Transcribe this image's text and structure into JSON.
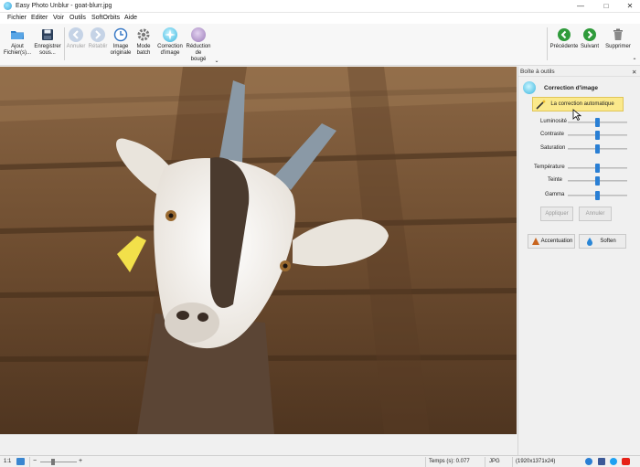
{
  "window": {
    "title": "Easy Photo Unblur - goat-blurr.jpg"
  },
  "menu": [
    "Fichier",
    "Editer",
    "Voir",
    "Outils",
    "SoftOrbits",
    "Aide"
  ],
  "toolbar": {
    "add_files": [
      "Ajout",
      "Fichier(s)..."
    ],
    "save_as": [
      "Enregistrer",
      "sous..."
    ],
    "undo": "Annuler",
    "redo": "Rétablir",
    "original_image": [
      "Image",
      "originale"
    ],
    "batch_mode": [
      "Mode",
      "batch"
    ],
    "image_correction": [
      "Correction",
      "d'image"
    ],
    "shake_reduction": [
      "Réduction",
      "de",
      "bougé"
    ],
    "previous": "Précédente",
    "next": "Suivant",
    "delete": "Supprimer"
  },
  "toolbox": {
    "title": "Boîte à outils",
    "section": "Correction d'image",
    "auto_button": "La correction automatique",
    "sliders": [
      {
        "label": "Luminosité",
        "value": 0.5
      },
      {
        "label": "Contraste",
        "value": 0.5
      },
      {
        "label": "Saturation",
        "value": 0.5
      },
      {
        "label": "Température",
        "value": 0.5
      },
      {
        "label": "Teinte",
        "value": 0.5
      },
      {
        "label": "Gamma",
        "value": 0.5
      }
    ],
    "apply": "Appliquer",
    "cancel": "Annuler",
    "sharpen": "Accentuation",
    "soften": "Soften"
  },
  "statusbar": {
    "zoom_ratio": "1:1",
    "time": "Temps (s): 0.077",
    "format": "JPG",
    "dimensions": "(1920x1371x24)"
  },
  "colors": {
    "accent": "#2a7fd4",
    "auto_button": "#fbe98b",
    "wood": "#6b4a2e"
  }
}
